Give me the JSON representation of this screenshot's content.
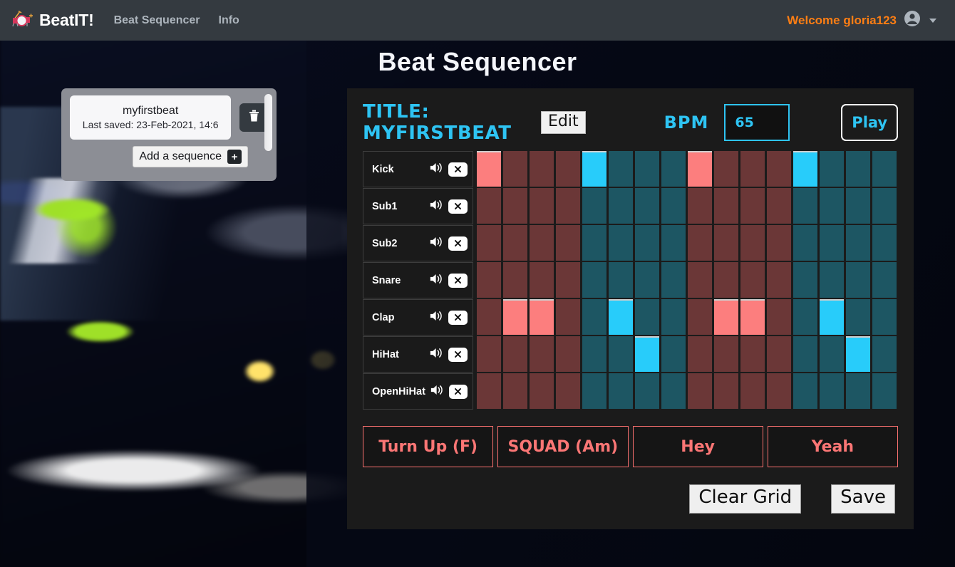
{
  "navbar": {
    "logo_icon": "drum-kit-icon",
    "brand": "BeatIT!",
    "links": [
      {
        "label": "Beat Sequencer"
      },
      {
        "label": "Info"
      }
    ],
    "welcome": "Welcome gloria123",
    "account_icon": "user-circle-icon",
    "caret_icon": "chevron-down-icon"
  },
  "page": {
    "title": "Beat Sequencer"
  },
  "sequence_panel": {
    "card": {
      "name": "myfirstbeat",
      "saved": "Last saved: 23-Feb-2021, 14:6"
    },
    "delete_icon": "trash-icon",
    "add_label": "Add a sequence",
    "add_icon": "plus-icon"
  },
  "sequencer": {
    "title_label": "TITLE: MYFIRSTBEAT",
    "edit_label": "Edit",
    "bpm_label": "BPM",
    "bpm_value": "65",
    "play_label": "Play",
    "clear_grid_label": "Clear Grid",
    "save_label": "Save",
    "accent_cyan": "#2ec4f3",
    "accent_red": "#fb7675",
    "columns": 16,
    "tracks": [
      {
        "name": "Kick",
        "speaker_icon": "speaker-icon",
        "clear_icon": "x-icon",
        "steps": [
          1,
          0,
          0,
          0,
          1,
          0,
          0,
          0,
          1,
          0,
          0,
          0,
          1,
          0,
          0,
          0
        ]
      },
      {
        "name": "Sub1",
        "speaker_icon": "speaker-icon",
        "clear_icon": "x-icon",
        "steps": [
          0,
          0,
          0,
          0,
          0,
          0,
          0,
          0,
          0,
          0,
          0,
          0,
          0,
          0,
          0,
          0
        ]
      },
      {
        "name": "Sub2",
        "speaker_icon": "speaker-icon",
        "clear_icon": "x-icon",
        "steps": [
          0,
          0,
          0,
          0,
          0,
          0,
          0,
          0,
          0,
          0,
          0,
          0,
          0,
          0,
          0,
          0
        ]
      },
      {
        "name": "Snare",
        "speaker_icon": "speaker-icon",
        "clear_icon": "x-icon",
        "steps": [
          0,
          0,
          0,
          0,
          0,
          0,
          0,
          0,
          0,
          0,
          0,
          0,
          0,
          0,
          0,
          0
        ]
      },
      {
        "name": "Clap",
        "speaker_icon": "speaker-icon",
        "clear_icon": "x-icon",
        "steps": [
          0,
          1,
          1,
          0,
          0,
          1,
          0,
          0,
          0,
          1,
          1,
          0,
          0,
          1,
          0,
          0
        ]
      },
      {
        "name": "HiHat",
        "speaker_icon": "speaker-icon",
        "clear_icon": "x-icon",
        "steps": [
          0,
          0,
          0,
          0,
          0,
          0,
          1,
          0,
          0,
          0,
          0,
          0,
          0,
          0,
          1,
          0
        ]
      },
      {
        "name": "OpenHiHat",
        "speaker_icon": "speaker-icon",
        "clear_icon": "x-icon",
        "steps": [
          0,
          0,
          0,
          0,
          0,
          0,
          0,
          0,
          0,
          0,
          0,
          0,
          0,
          0,
          0,
          0
        ]
      }
    ],
    "samples": [
      {
        "label": "Turn Up (F)"
      },
      {
        "label": "SQUAD (Am)"
      },
      {
        "label": "Hey"
      },
      {
        "label": "Yeah"
      }
    ]
  }
}
